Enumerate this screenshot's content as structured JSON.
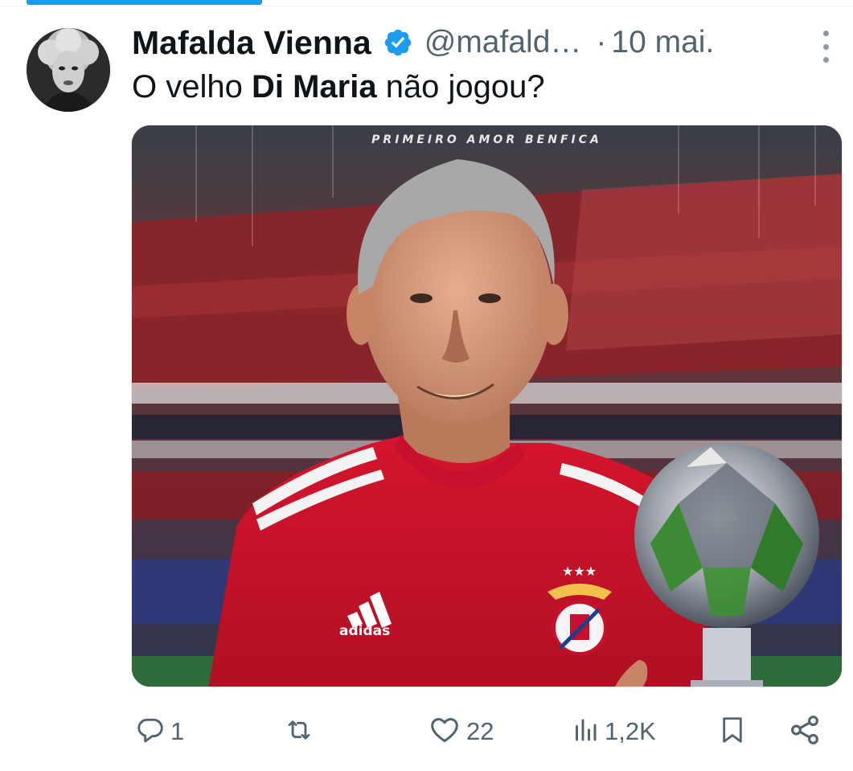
{
  "tweet": {
    "author": {
      "display_name": "Mafalda Vienna",
      "handle": "@mafald…",
      "verified": true
    },
    "separator": "·",
    "date": "10 mai.",
    "text": {
      "before": "O velho ",
      "bold": "Di Maria",
      "after": " não jogou?"
    },
    "media": {
      "caption": "PRIMEIRO   AMOR   BENFICA",
      "brand_mark": "adidas"
    },
    "actions": {
      "replies": "1",
      "retweets": "",
      "likes": "22",
      "views": "1,2K"
    }
  },
  "icons": {
    "reply": "reply-icon",
    "retweet": "retweet-icon",
    "like": "heart-icon",
    "views": "views-icon",
    "bookmark": "bookmark-icon",
    "share": "share-icon",
    "more": "more-options-icon",
    "verified": "verified-badge-icon"
  },
  "colors": {
    "accent": "#1d9bf0",
    "text_primary": "#0f1419",
    "text_secondary": "#536471",
    "jersey_red": "#c8102e"
  }
}
